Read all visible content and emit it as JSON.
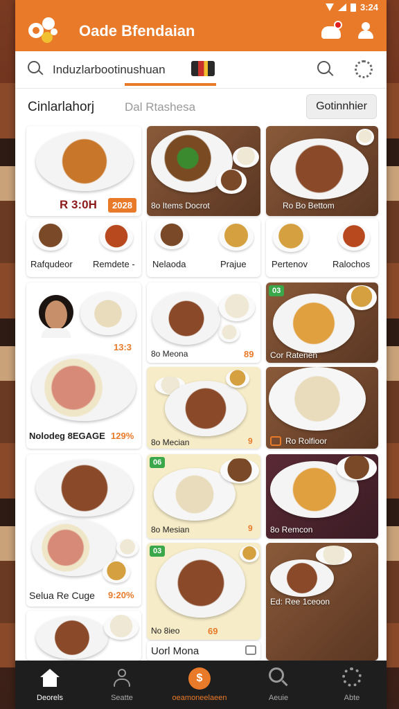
{
  "status_bar": {
    "time": "3:24"
  },
  "header": {
    "title": "Oade Bfendaian"
  },
  "search": {
    "value": "Induzlarbootinushuan"
  },
  "section": {
    "title": "Cinlarlahorj",
    "subtitle": "Dal Rtashesa",
    "filter_label": "Gotinnhier"
  },
  "cards": {
    "c1": {
      "price": "R 3:0H",
      "tag": "2028"
    },
    "c2": {
      "label": "8o Items Docrot"
    },
    "c3": {
      "label": "Ro Bo Bettom"
    },
    "row2": [
      "Rafqudeor",
      "Remdete -",
      "Nelaoda",
      "Prajue",
      "Pertenov",
      "Ralochos"
    ],
    "c4": {
      "tag": "13:3",
      "label": "Nolodeg 8EGAGE",
      "price": "129%"
    },
    "c5": {
      "label": "8o Meona",
      "price": "89"
    },
    "c6": {
      "badge": "03",
      "label": "Cor Ratenen"
    },
    "c7": {
      "label": "8o Mecian",
      "tag": "9"
    },
    "c8": {
      "label": "Ro Rolfioor"
    },
    "c9": {
      "label": "Selua Re Cuge",
      "price": "9:20%"
    },
    "c10": {
      "badge": "06",
      "label": "8o Mesian",
      "tag": "9"
    },
    "c11": {
      "label": "8o Remcon"
    },
    "c12": {
      "badge": "03",
      "label": "No 8ieo",
      "price": "69"
    },
    "c13": {
      "label": "Ed: Ree 1ceoon"
    },
    "c14": {
      "label": "Uorl Mona"
    }
  },
  "nav": {
    "home": "Deorels",
    "seatte": "Seatte",
    "center": "oeamoneelaeen",
    "find": "Aeuie",
    "more": "Abte"
  },
  "colors": {
    "accent": "#e87a2a",
    "nav_bg": "#1e1e1e",
    "badge": "#3aa84a"
  }
}
